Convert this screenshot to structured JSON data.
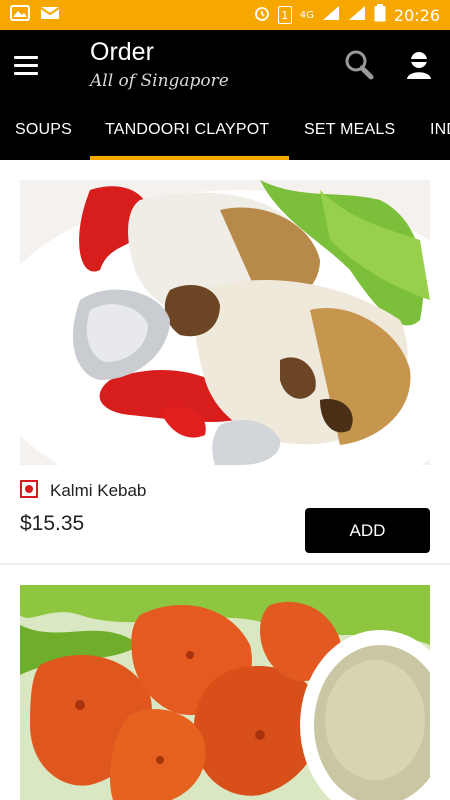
{
  "status_bar": {
    "time": "20:26",
    "network": "4G",
    "sim": "1",
    "icons": [
      "gallery-icon",
      "mail-icon",
      "alarm-icon",
      "sim-icon",
      "signal-icon",
      "battery-icon"
    ],
    "background": "#f6a800"
  },
  "app_bar": {
    "title": "Order",
    "subtitle": "All of Singapore",
    "menu_icon": "menu-icon",
    "search_icon": "search-icon",
    "profile_icon": "profile-icon"
  },
  "tabs": [
    {
      "label": "SOUPS",
      "active": false
    },
    {
      "label": "TANDOORI CLAYPOT",
      "active": true
    },
    {
      "label": "SET MEALS",
      "active": false
    },
    {
      "label": "INDIAN",
      "active": false
    }
  ],
  "accent_color": "#f6a800",
  "items": [
    {
      "name": "Kalmi Kebab",
      "price": "$15.35",
      "add_label": "ADD",
      "marker": "non-veg-mark",
      "image": "grilled-chicken-image"
    },
    {
      "name": "",
      "price": "",
      "add_label": "",
      "marker": "",
      "image": "chicken-tikka-image"
    }
  ]
}
